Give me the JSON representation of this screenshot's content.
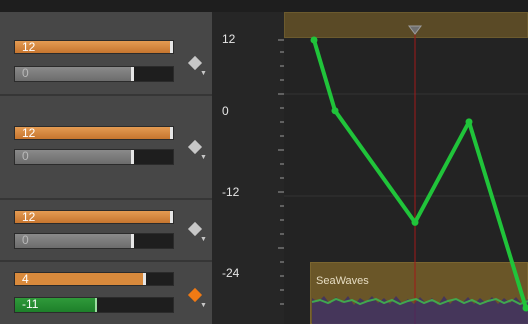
{
  "ruler": {
    "labels": [
      "12",
      "0",
      "-12",
      "-24"
    ]
  },
  "tracks": [
    {
      "volume": "12",
      "pan": "0",
      "volume_level": 1.0,
      "pan_level": 0.73,
      "keyframe_active": false
    },
    {
      "volume": "12",
      "pan": "0",
      "volume_level": 1.0,
      "pan_level": 0.73,
      "keyframe_active": false
    },
    {
      "volume": "12",
      "pan": "0",
      "volume_level": 1.0,
      "pan_level": 0.73,
      "keyframe_active": false
    },
    {
      "volume": "4",
      "pan": "-11",
      "volume_level": 0.82,
      "pan_level": 0.5,
      "keyframe_active": true
    }
  ],
  "clip": {
    "label": "SeaWaves"
  },
  "envelope": {
    "points_db": [
      12,
      2.5,
      -12.5,
      1,
      -24
    ]
  },
  "colors": {
    "accent": "#e49b52",
    "envelope": "#20c43a",
    "playhead": "#a21818",
    "active_keyframe": "#f07a14"
  },
  "icons": {
    "keyframe": "diamond-icon",
    "dropdown": "chevron-down-icon",
    "playhead": "playhead-marker-icon"
  }
}
